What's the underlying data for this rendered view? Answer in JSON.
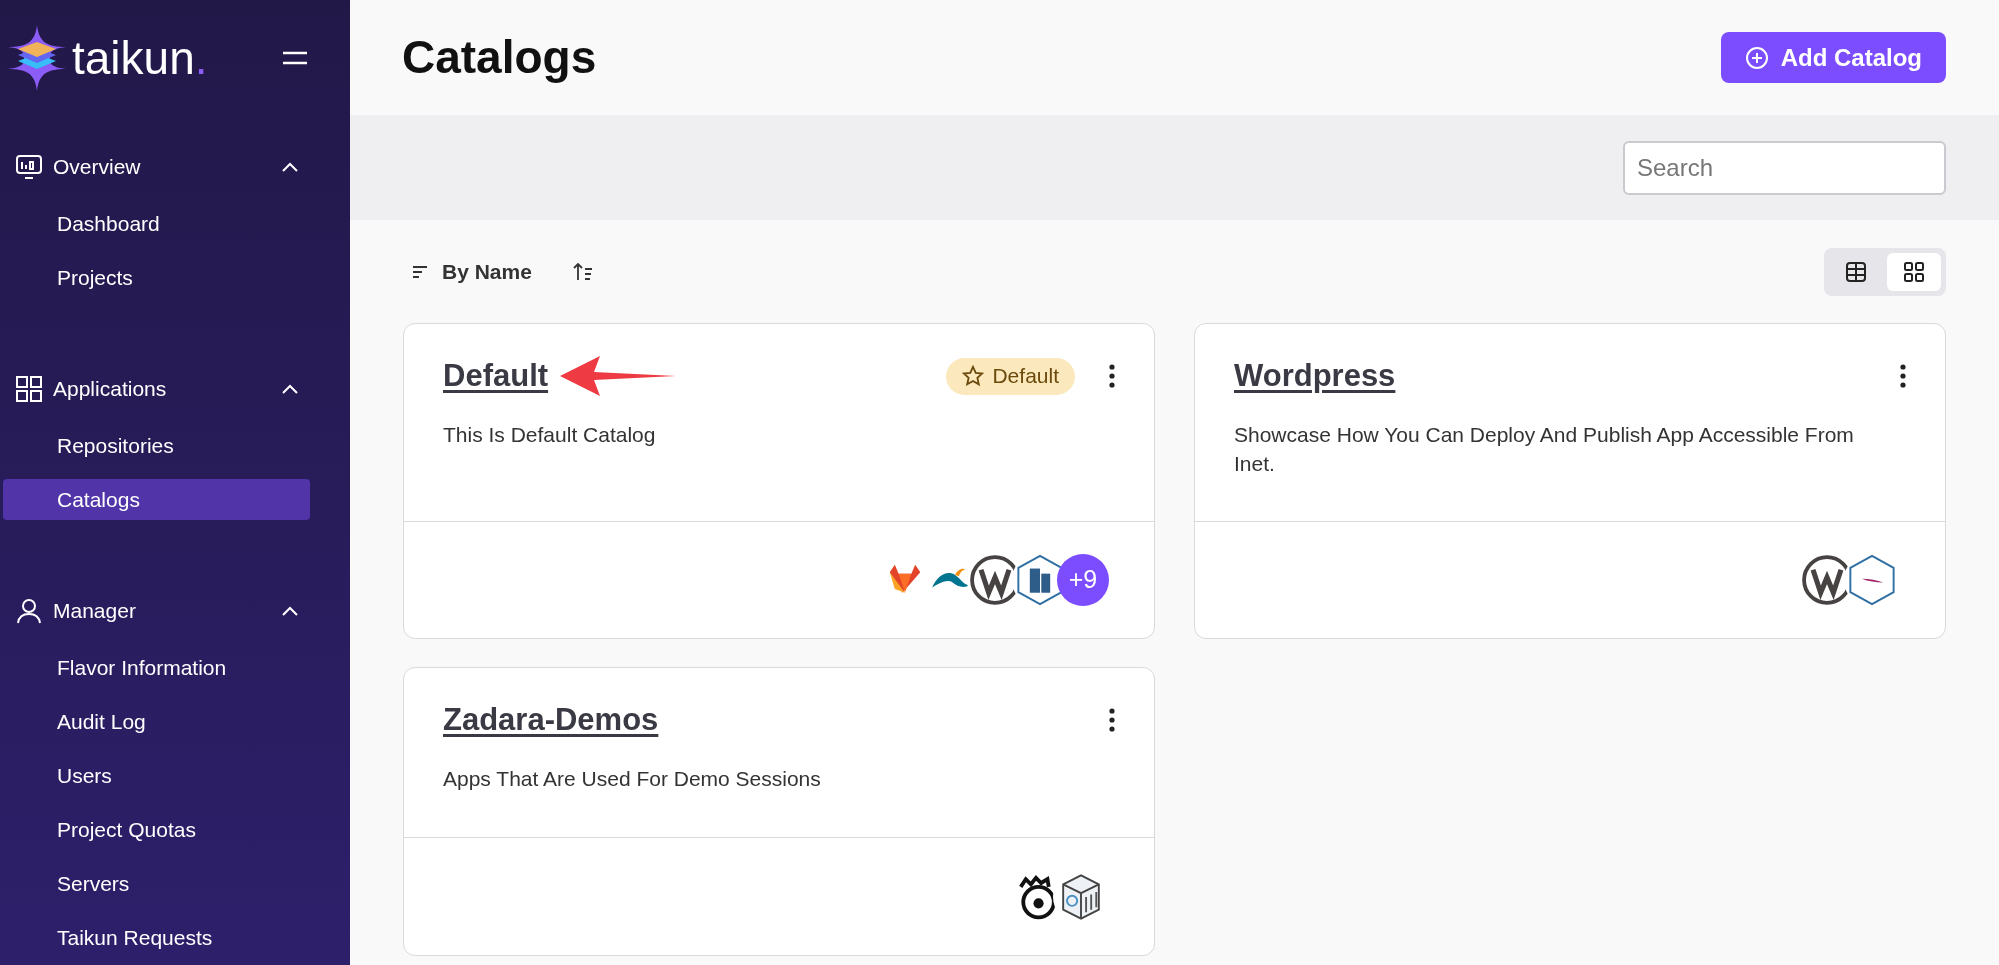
{
  "sidebar": {
    "logo": {
      "text": "taikun",
      "dot": "."
    },
    "sections": [
      {
        "label": "Overview",
        "expanded": true,
        "items": [
          {
            "label": "Dashboard",
            "selected": false
          },
          {
            "label": "Projects",
            "selected": false
          }
        ]
      },
      {
        "label": "Applications",
        "expanded": true,
        "items": [
          {
            "label": "Repositories",
            "selected": false
          },
          {
            "label": "Catalogs",
            "selected": true
          }
        ]
      },
      {
        "label": "Manager",
        "expanded": true,
        "items": [
          {
            "label": "Flavor Information",
            "selected": false
          },
          {
            "label": "Audit Log",
            "selected": false
          },
          {
            "label": "Users",
            "selected": false
          },
          {
            "label": "Project Quotas",
            "selected": false
          },
          {
            "label": "Servers",
            "selected": false
          },
          {
            "label": "Taikun Requests",
            "selected": false
          }
        ]
      }
    ]
  },
  "header": {
    "title": "Catalogs",
    "add_button": "Add Catalog"
  },
  "search": {
    "placeholder": "Search"
  },
  "sort": {
    "label": "By Name"
  },
  "view_toggle": [
    {
      "kind": "table",
      "selected": false
    },
    {
      "kind": "grid",
      "selected": true
    }
  ],
  "catalogs": [
    {
      "title": "Default",
      "description": "This Is Default Catalog",
      "badge": "Default",
      "apps": [
        {
          "kind": "gitlab"
        },
        {
          "kind": "mysql"
        },
        {
          "kind": "wordpress"
        },
        {
          "kind": "building"
        }
      ],
      "more": "+9"
    },
    {
      "title": "Wordpress",
      "description": "Showcase How You Can Deploy And Publish App Accessible From Inet.",
      "apps": [
        {
          "kind": "wordpress"
        },
        {
          "kind": "feather"
        }
      ]
    },
    {
      "title": "Zadara-Demos",
      "description": "Apps That Are Used For Demo Sessions",
      "apps": [
        {
          "kind": "bear"
        },
        {
          "kind": "box"
        }
      ]
    }
  ]
}
